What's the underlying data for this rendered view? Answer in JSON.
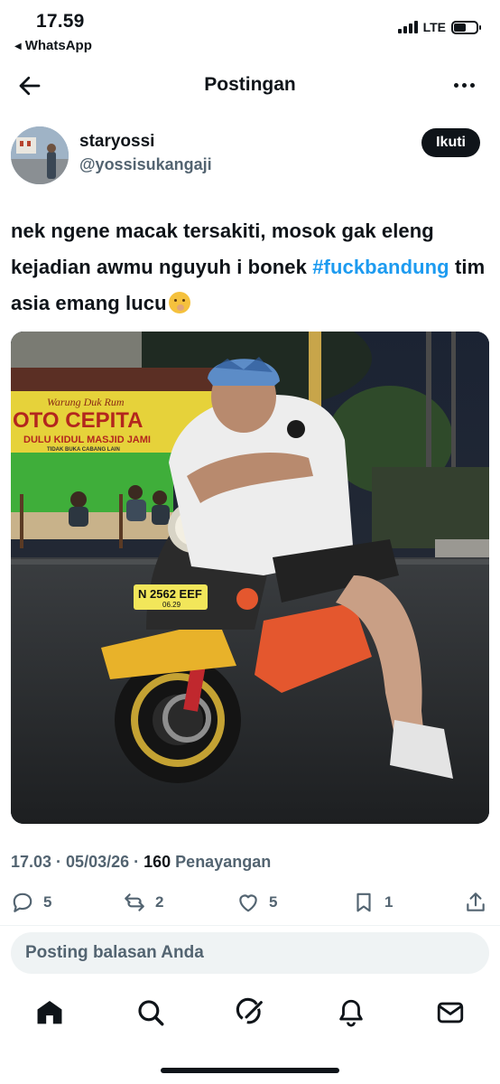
{
  "status_bar": {
    "time": "17.59",
    "back_app": "WhatsApp",
    "network": "LTE"
  },
  "header": {
    "title": "Postingan"
  },
  "author": {
    "name": "staryossi",
    "handle": "@yossisukangaji",
    "follow_label": "Ikuti"
  },
  "tweet": {
    "text_part1": "nek ngene macak tersakiti, mosok gak eleng kejadian awmu nguyuh i bonek",
    "hashtag": "#fuckbandung",
    "text_part2": " tim asia emang lucu",
    "emoji": "face-with-hand-over-mouth"
  },
  "media": {
    "sign_line1": "Warung Duk Rum",
    "sign_line2": "OTO CEPITA",
    "sign_line3": "DULU KIDUL MASJID JAMI",
    "sign_line4": "TIDAK BUKA CABANG LAIN",
    "plate": "N 2562 EEF",
    "plate_sub": "06.29"
  },
  "meta": {
    "time": "17.03",
    "separator1": " · ",
    "date": "05/03/26",
    "separator2": " · ",
    "views_count": "160",
    "views_label": " Penayangan"
  },
  "actions": {
    "replies": "5",
    "reposts": "2",
    "likes": "5",
    "bookmarks": "1"
  },
  "reply": {
    "placeholder": "Posting balasan Anda"
  },
  "icons": {
    "back": "arrow-left-icon",
    "more": "more-icon",
    "reply": "reply-icon",
    "repost": "repost-icon",
    "like": "heart-icon",
    "bookmark": "bookmark-icon",
    "share": "share-icon",
    "home": "home-icon",
    "search": "search-icon",
    "grok": "grok-icon",
    "notifications": "bell-icon",
    "messages": "mail-icon"
  },
  "colors": {
    "accent": "#1d9bf0",
    "text": "#0f1419",
    "secondary": "#536471"
  }
}
